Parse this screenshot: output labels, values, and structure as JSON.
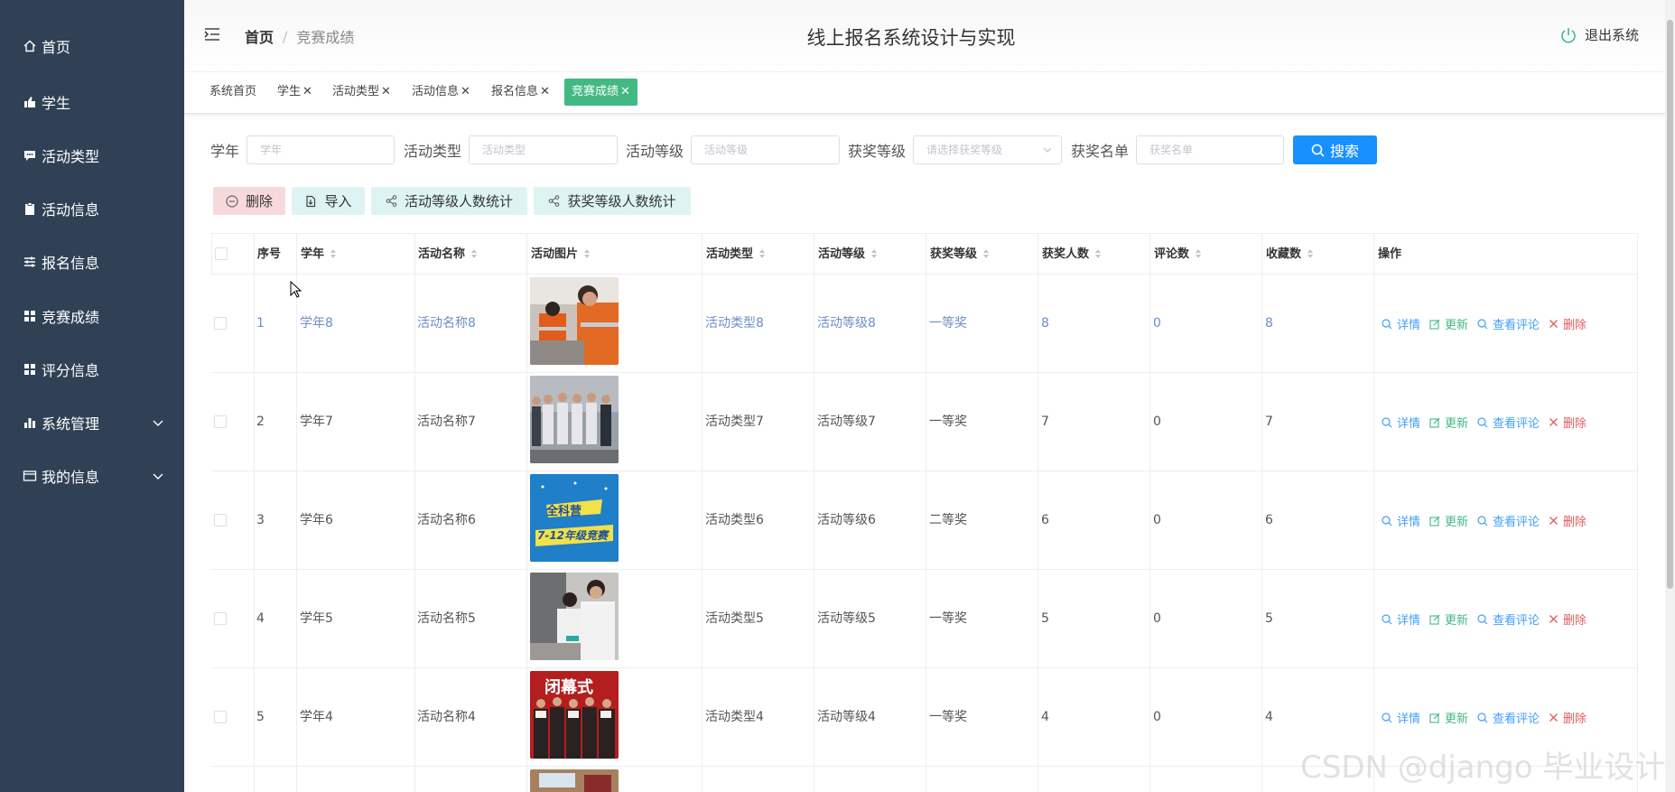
{
  "sidebar": {
    "items": [
      {
        "label": "首页",
        "icon": "home-icon"
      },
      {
        "label": "学生",
        "icon": "thumb-up-icon"
      },
      {
        "label": "活动类型",
        "icon": "comment-icon"
      },
      {
        "label": "活动信息",
        "icon": "clipboard-icon"
      },
      {
        "label": "报名信息",
        "icon": "sliders-icon"
      },
      {
        "label": "竞赛成绩",
        "icon": "grid-icon"
      },
      {
        "label": "评分信息",
        "icon": "grid-icon"
      },
      {
        "label": "系统管理",
        "icon": "bar-chart-icon"
      },
      {
        "label": "我的信息",
        "icon": "card-icon"
      }
    ]
  },
  "header": {
    "breadcrumb_home": "首页",
    "breadcrumb_sep": "/",
    "breadcrumb_current": "竞赛成绩",
    "title": "线上报名系统设计与实现",
    "logout": "退出系统"
  },
  "tags": [
    {
      "label": "系统首页",
      "closable": false
    },
    {
      "label": "学生",
      "closable": true
    },
    {
      "label": "活动类型",
      "closable": true
    },
    {
      "label": "活动信息",
      "closable": true
    },
    {
      "label": "报名信息",
      "closable": true
    },
    {
      "label": "竞赛成绩",
      "closable": true,
      "active": true
    }
  ],
  "search": {
    "year_label": "学年",
    "year_placeholder": "学年",
    "type_label": "活动类型",
    "type_placeholder": "活动类型",
    "level_label": "活动等级",
    "level_placeholder": "活动等级",
    "award_label": "获奖等级",
    "award_placeholder": "请选择获奖等级",
    "list_label": "获奖名单",
    "list_placeholder": "获奖名单",
    "button": "搜索"
  },
  "actions": {
    "delete": "删除",
    "import": "导入",
    "stat_level": "活动等级人数统计",
    "stat_award": "获奖等级人数统计"
  },
  "table": {
    "columns": [
      "序号",
      "学年",
      "活动名称",
      "活动图片",
      "活动类型",
      "活动等级",
      "获奖等级",
      "获奖人数",
      "评论数",
      "收藏数",
      "操作"
    ],
    "ops": {
      "detail": "详情",
      "update": "更新",
      "comments": "查看评论",
      "delete": "删除"
    },
    "rows": [
      {
        "no": "1",
        "year": "学年8",
        "name": "活动名称8",
        "type": "活动类型8",
        "level": "活动等级8",
        "award": "一等奖",
        "winners": "8",
        "comments": "0",
        "favorites": "8",
        "image": "workers-orange-uniform"
      },
      {
        "no": "2",
        "year": "学年7",
        "name": "活动名称7",
        "type": "活动类型7",
        "level": "活动等级7",
        "award": "一等奖",
        "winners": "7",
        "comments": "0",
        "favorites": "7",
        "image": "group-standing-photo"
      },
      {
        "no": "3",
        "year": "学年6",
        "name": "活动名称6",
        "type": "活动类型6",
        "level": "活动等级6",
        "award": "二等奖",
        "winners": "6",
        "comments": "0",
        "favorites": "6",
        "image": "competition-poster",
        "poster_line1": "全科营",
        "poster_line2": "7-12年级竞赛"
      },
      {
        "no": "4",
        "year": "学年5",
        "name": "活动名称5",
        "type": "活动类型5",
        "level": "活动等级5",
        "award": "一等奖",
        "winners": "5",
        "comments": "0",
        "favorites": "5",
        "image": "lab-students"
      },
      {
        "no": "5",
        "year": "学年4",
        "name": "活动名称4",
        "type": "活动类型4",
        "level": "活动等级4",
        "award": "一等奖",
        "winners": "4",
        "comments": "0",
        "favorites": "4",
        "image": "closing-ceremony",
        "poster_line1": "闭幕式"
      }
    ]
  },
  "watermark": "CSDN @django 毕业设计",
  "colors": {
    "sidebar_bg": "#304156",
    "active_tag": "#42b983",
    "primary": "#1890ff",
    "link_blue": "#409eff",
    "update_green": "#42b983",
    "delete_red": "#e05c5c"
  }
}
